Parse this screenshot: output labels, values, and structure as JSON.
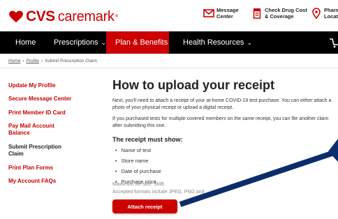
{
  "brand": {
    "name_bold": "CVS",
    "name_light": "caremark",
    "color": "#cc0000"
  },
  "utility": [
    {
      "icon": "envelope-icon",
      "label": "Message Center"
    },
    {
      "icon": "drug-cost-icon",
      "label": "Check Drug Cost & Coverage"
    },
    {
      "icon": "location-pin-icon",
      "label": "Pharma Locato"
    }
  ],
  "nav": {
    "items": [
      {
        "label": "Home",
        "active": false,
        "dropdown": false
      },
      {
        "label": "Prescriptions",
        "active": false,
        "dropdown": true
      },
      {
        "label": "Plan & Benefits",
        "active": true,
        "dropdown": false
      },
      {
        "label": "Health Resources",
        "active": false,
        "dropdown": true
      }
    ],
    "cart_icon": "cart-icon"
  },
  "breadcrumb": {
    "items": [
      "Home",
      "Profile",
      "Submit Prescription Claim"
    ]
  },
  "sidebar": {
    "items": [
      {
        "label": "Update My Profile"
      },
      {
        "label": "Secure Message Center"
      },
      {
        "label": "Print Member ID Card"
      },
      {
        "label": "Pay Mail Account Balance"
      },
      {
        "label": "Submit Prescription Claim",
        "current": true
      },
      {
        "label": "Print Plan Forms"
      },
      {
        "label": "My Account FAQs"
      }
    ]
  },
  "main": {
    "title": "How to upload your receipt",
    "para1": "Next, you'll need to attach a receipt of your at-home COVID-19 test purchase. You can either attach a photo of your physical receipt or upload a digital receipt.",
    "para2": "If you purchased tests for multiple covered members on the same receipt, you can file another claim after submitting this one.",
    "must_show_heading": "The receipt must show:",
    "must_show": [
      "Name of test",
      "Store name",
      "Date of purchase",
      "Purchase price"
    ],
    "max_size": "Maximum file size: 3MB",
    "formats": "Accepted formats include JPEG, PNG and",
    "attach_button": "Attach receipt"
  },
  "annotation": {
    "type": "pointer-arrow",
    "color": "#0b2d6b"
  }
}
